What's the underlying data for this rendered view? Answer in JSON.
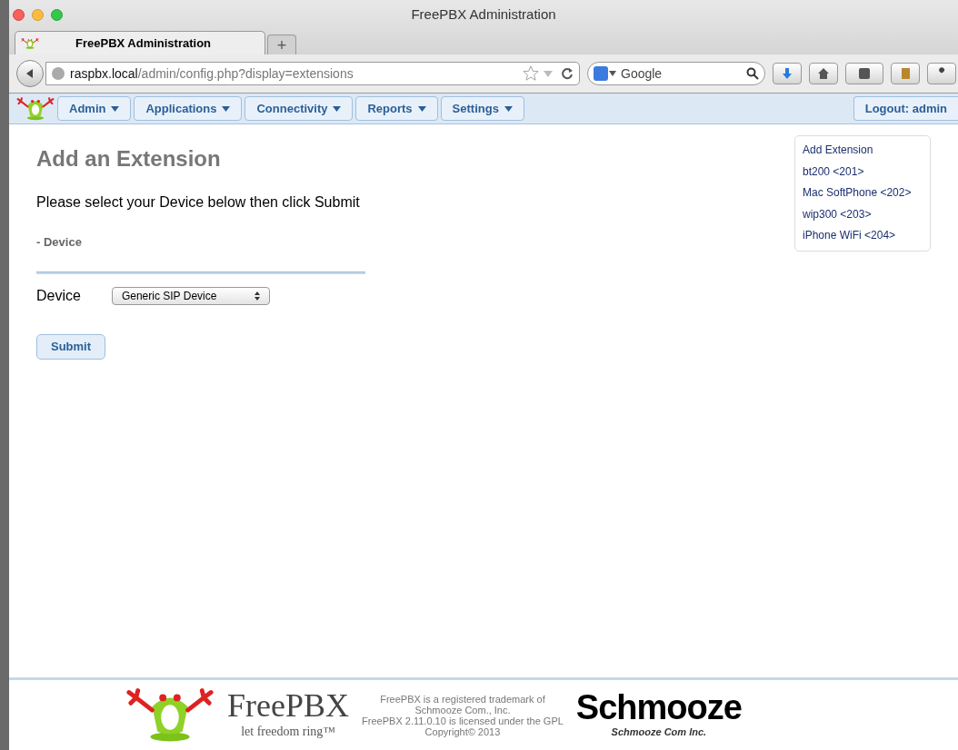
{
  "window": {
    "title": "FreePBX Administration"
  },
  "tabs": [
    {
      "label": "FreePBX Administration",
      "selected": true
    }
  ],
  "new_tab": "+",
  "address_bar": {
    "host": "raspbx.local",
    "path": "/admin/config.php?display=extensions"
  },
  "search": {
    "placeholder": "Google"
  },
  "nav": {
    "menus": [
      "Admin",
      "Applications",
      "Connectivity",
      "Reports",
      "Settings"
    ],
    "logout": "Logout: admin"
  },
  "page": {
    "title": "Add an Extension",
    "instruction": "Please select your Device below then click Submit",
    "section": "- Device",
    "device_label": "Device",
    "device_value": "Generic SIP Device",
    "submit": "Submit"
  },
  "sidebar": {
    "items": [
      "Add Extension",
      "bt200 <201>",
      "Mac SoftPhone <202>",
      "wip300 <203>",
      "iPhone WiFi <204>"
    ]
  },
  "footer": {
    "brand": "FreePBX",
    "tagline": "let freedom ring™",
    "legal": [
      "FreePBX is a registered trademark of",
      "Schmooze Com., Inc.",
      "FreePBX 2.11.0.10 is licensed under the GPL",
      "Copyright© 2013"
    ],
    "company": "Schmooze",
    "company_sub": "Schmooze Com Inc."
  }
}
